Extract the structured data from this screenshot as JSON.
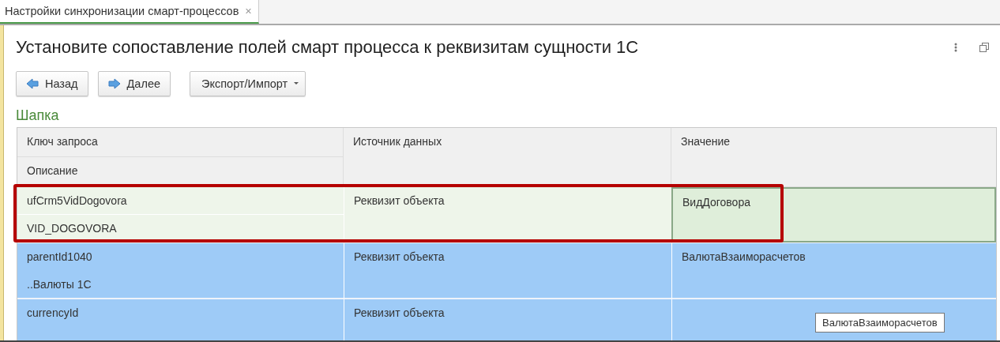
{
  "tabs": [
    {
      "label": "Настройки синхронизации смарт-процессов",
      "selected": true,
      "close": "×"
    }
  ],
  "title": "Установите сопоставление полей смарт процесса к реквизитам сущности 1С",
  "buttons": [
    {
      "label": "Назад",
      "kind": "back"
    },
    {
      "label": "Далее",
      "kind": "next"
    },
    {
      "label": "Экспорт/Импорт",
      "kind": "menu"
    }
  ],
  "section": "Шапка",
  "table": {
    "columns": [
      "Ключ запроса",
      "Источник данных",
      "Значение"
    ],
    "subcolumn": "Описание",
    "rows": [
      {
        "key": "ufCrm5VidDogovora",
        "description": "VID_DOGOVORA",
        "source": "Реквизит объекта",
        "value": "ВидДоговора",
        "current": true,
        "selected": false,
        "highlighted": true
      },
      {
        "key": "parentId1040",
        "description": "..Валюты 1С",
        "source": "Реквизит объекта",
        "value": "ВалютаВзаиморасчетов",
        "current": false,
        "selected": true,
        "highlighted": false
      },
      {
        "key": "currencyId",
        "source": "Реквизит объекта",
        "current": false,
        "selected": true,
        "highlighted": false
      }
    ]
  },
  "tooltip": "ВалютаВзаиморасчетов"
}
